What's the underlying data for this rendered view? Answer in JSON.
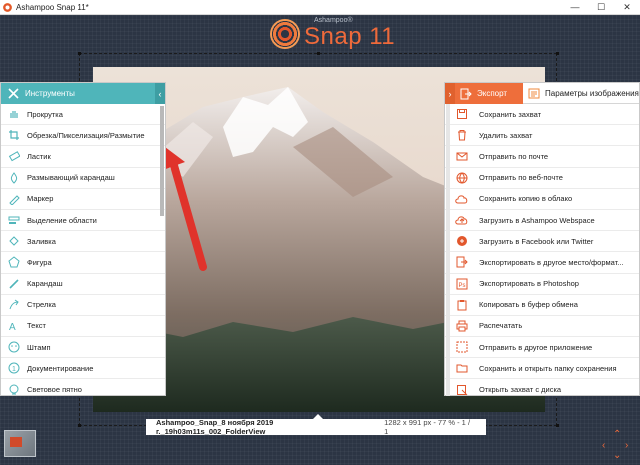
{
  "window": {
    "title": "Ashampoo Snap 11*",
    "controls": [
      "minimize",
      "maximize",
      "close"
    ]
  },
  "logo": {
    "small": "Ashampoo®",
    "brand": "Snap 11"
  },
  "tools": {
    "header": "Инструменты",
    "items": [
      {
        "label": "Прокрутка",
        "icon": "hand-icon"
      },
      {
        "label": "Обрезка/Пикселизация/Размытие",
        "icon": "crop-icon"
      },
      {
        "label": "Ластик",
        "icon": "eraser-icon"
      },
      {
        "label": "Размывающий карандаш",
        "icon": "blur-pencil-icon"
      },
      {
        "label": "Маркер",
        "icon": "marker-icon"
      },
      {
        "label": "Выделение области",
        "icon": "highlight-area-icon"
      },
      {
        "label": "Заливка",
        "icon": "fill-icon"
      },
      {
        "label": "Фигура",
        "icon": "shape-icon"
      },
      {
        "label": "Карандаш",
        "icon": "pencil-icon"
      },
      {
        "label": "Стрелка",
        "icon": "arrow-icon"
      },
      {
        "label": "Текст",
        "icon": "text-icon"
      },
      {
        "label": "Штамп",
        "icon": "stamp-icon"
      },
      {
        "label": "Документирование",
        "icon": "numbering-icon"
      },
      {
        "label": "Световое пятно",
        "icon": "spotlight-icon"
      }
    ]
  },
  "export": {
    "tab_export": "Экспорт",
    "tab_params": "Параметры изображения",
    "items": [
      {
        "label": "Сохранить захват",
        "icon": "save-icon"
      },
      {
        "label": "Удалить захват",
        "icon": "delete-icon"
      },
      {
        "label": "Отправить по почте",
        "icon": "mail-icon"
      },
      {
        "label": "Отправить по веб-почте",
        "icon": "webmail-icon"
      },
      {
        "label": "Сохранить копию в облако",
        "icon": "cloud-icon"
      },
      {
        "label": "Загрузить в Ashampoo Webspace",
        "icon": "upload-cloud-icon"
      },
      {
        "label": "Загрузить в Facebook или Twitter",
        "icon": "share-icon"
      },
      {
        "label": "Экспортировать в другое место/формат...",
        "icon": "export-icon"
      },
      {
        "label": "Экспортировать в Photoshop",
        "icon": "photoshop-icon"
      },
      {
        "label": "Копировать в буфер обмена",
        "icon": "clipboard-icon"
      },
      {
        "label": "Распечатать",
        "icon": "print-icon"
      },
      {
        "label": "Отправить в другое приложение",
        "icon": "open-app-icon"
      },
      {
        "label": "Сохранить и открыть папку сохранения",
        "icon": "folder-icon"
      },
      {
        "label": "Открыть захват с диска",
        "icon": "open-file-icon"
      }
    ]
  },
  "filebar": {
    "filename": "Ashampoo_Snap_8 ноября 2019 г._19h03m11s_002_FolderView",
    "meta": "1282 x 991 px - 77 % - 1 / 1"
  },
  "colors": {
    "accent_tools": "#4fb5ba",
    "accent_export": "#ee6e3b",
    "arrow_annotation": "#e0332b"
  }
}
